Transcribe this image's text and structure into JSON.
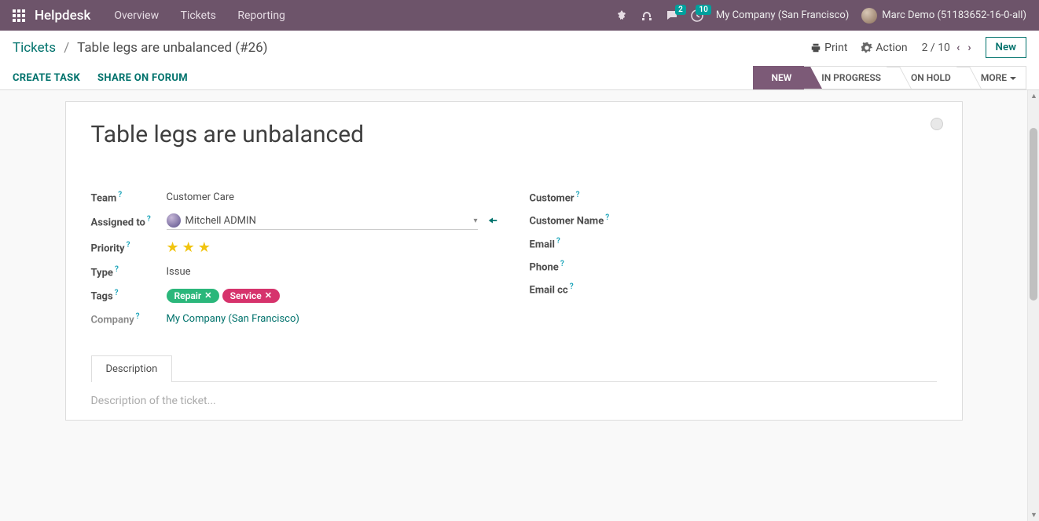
{
  "navbar": {
    "brand": "Helpdesk",
    "menu": [
      "Overview",
      "Tickets",
      "Reporting"
    ],
    "messages_badge": "2",
    "activities_badge": "10",
    "company": "My Company (San Francisco)",
    "username": "Marc Demo (51183652-16-0-all)"
  },
  "control_panel": {
    "breadcrumb_root": "Tickets",
    "breadcrumb_current": "Table legs are unbalanced (#26)",
    "print_label": "Print",
    "action_label": "Action",
    "pager_pos": "2",
    "pager_total": "10",
    "new_label": "New",
    "toolbar": {
      "create_task": "CREATE TASK",
      "share_forum": "SHARE ON FORUM"
    },
    "status_steps": {
      "new": "NEW",
      "in_progress": "IN PROGRESS",
      "on_hold": "ON HOLD",
      "more": "MORE"
    }
  },
  "ticket": {
    "title": "Table legs are unbalanced",
    "labels": {
      "team": "Team",
      "assigned_to": "Assigned to",
      "priority": "Priority",
      "type": "Type",
      "tags": "Tags",
      "company": "Company",
      "customer": "Customer",
      "customer_name": "Customer Name",
      "email": "Email",
      "phone": "Phone",
      "email_cc": "Email cc"
    },
    "team": "Customer Care",
    "assigned_to": "Mitchell ADMIN",
    "type": "Issue",
    "tags": [
      {
        "label": "Repair",
        "color": "repair"
      },
      {
        "label": "Service",
        "color": "service"
      }
    ],
    "company_value": "My Company (San Francisco)",
    "priority_stars": 3
  },
  "tabs": {
    "description": "Description"
  },
  "description_placeholder": "Description of the ticket..."
}
